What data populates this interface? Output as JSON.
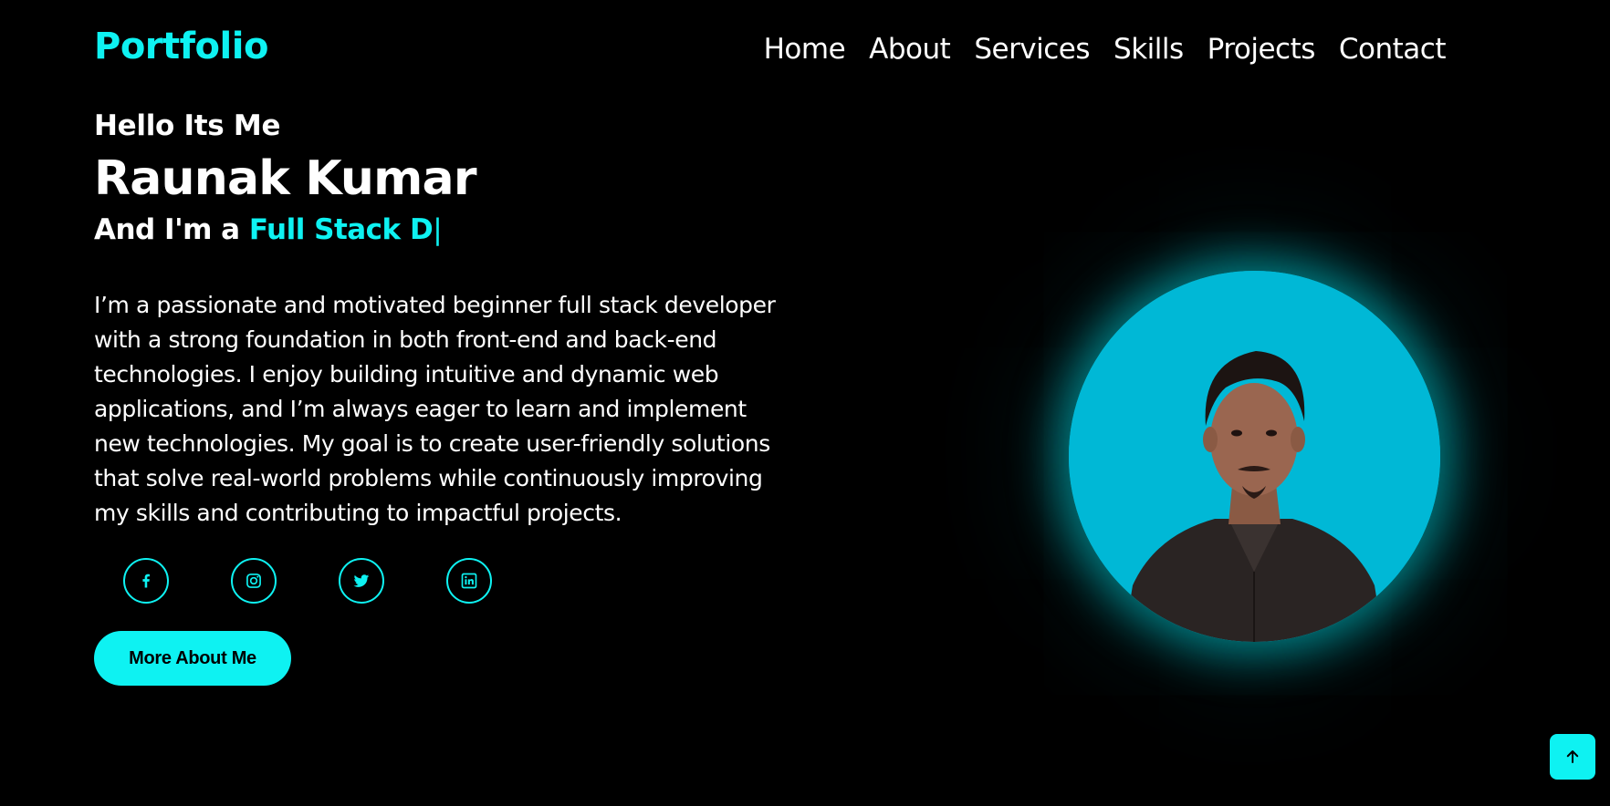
{
  "header": {
    "logo": "Portfolio",
    "nav": [
      "Home",
      "About",
      "Services",
      "Skills",
      "Projects",
      "Contact"
    ]
  },
  "hero": {
    "greeting": "Hello Its Me",
    "name": "Raunak Kumar",
    "role_prefix": "And I'm a ",
    "role_typed": "Full Stack D",
    "cursor": "|",
    "bio": "I’m a passionate and motivated beginner full stack developer with a strong foundation in both front-end and back-end technologies. I enjoy building intuitive and dynamic web applications, and I’m always eager to learn and implement new technologies. My goal is to create user-friendly solutions that solve real-world problems while continuously improving my skills and contributing to impactful projects.",
    "socials": [
      "facebook-icon",
      "instagram-icon",
      "twitter-icon",
      "linkedin-icon"
    ],
    "button_label": "More About Me"
  },
  "colors": {
    "accent": "#0ef2f2",
    "background": "#000000",
    "photo_bg": "#00b8d6"
  },
  "scroll_top_icon": "arrow-up-icon"
}
